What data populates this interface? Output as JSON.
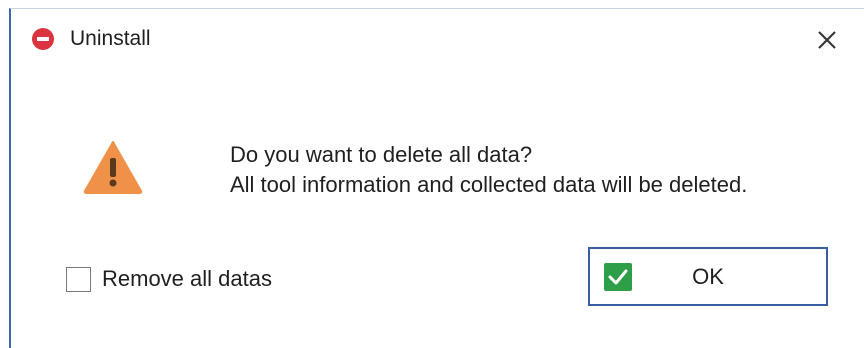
{
  "window": {
    "title": "Uninstall",
    "title_icon": "stop-icon",
    "close_icon": "close-icon"
  },
  "message": {
    "icon": "warning-icon",
    "line1": "Do you want to delete all data?",
    "line2": "All tool information and collected data will be deleted."
  },
  "options": {
    "remove_all_label": "Remove all datas",
    "remove_all_checked": false
  },
  "buttons": {
    "ok_label": "OK",
    "ok_icon": "checkmark-icon"
  },
  "colors": {
    "title_icon_red": "#d9343f",
    "warning_orange": "#f0914a",
    "ok_check_green": "#2e9e48",
    "border_blue": "#3a5ea3"
  }
}
